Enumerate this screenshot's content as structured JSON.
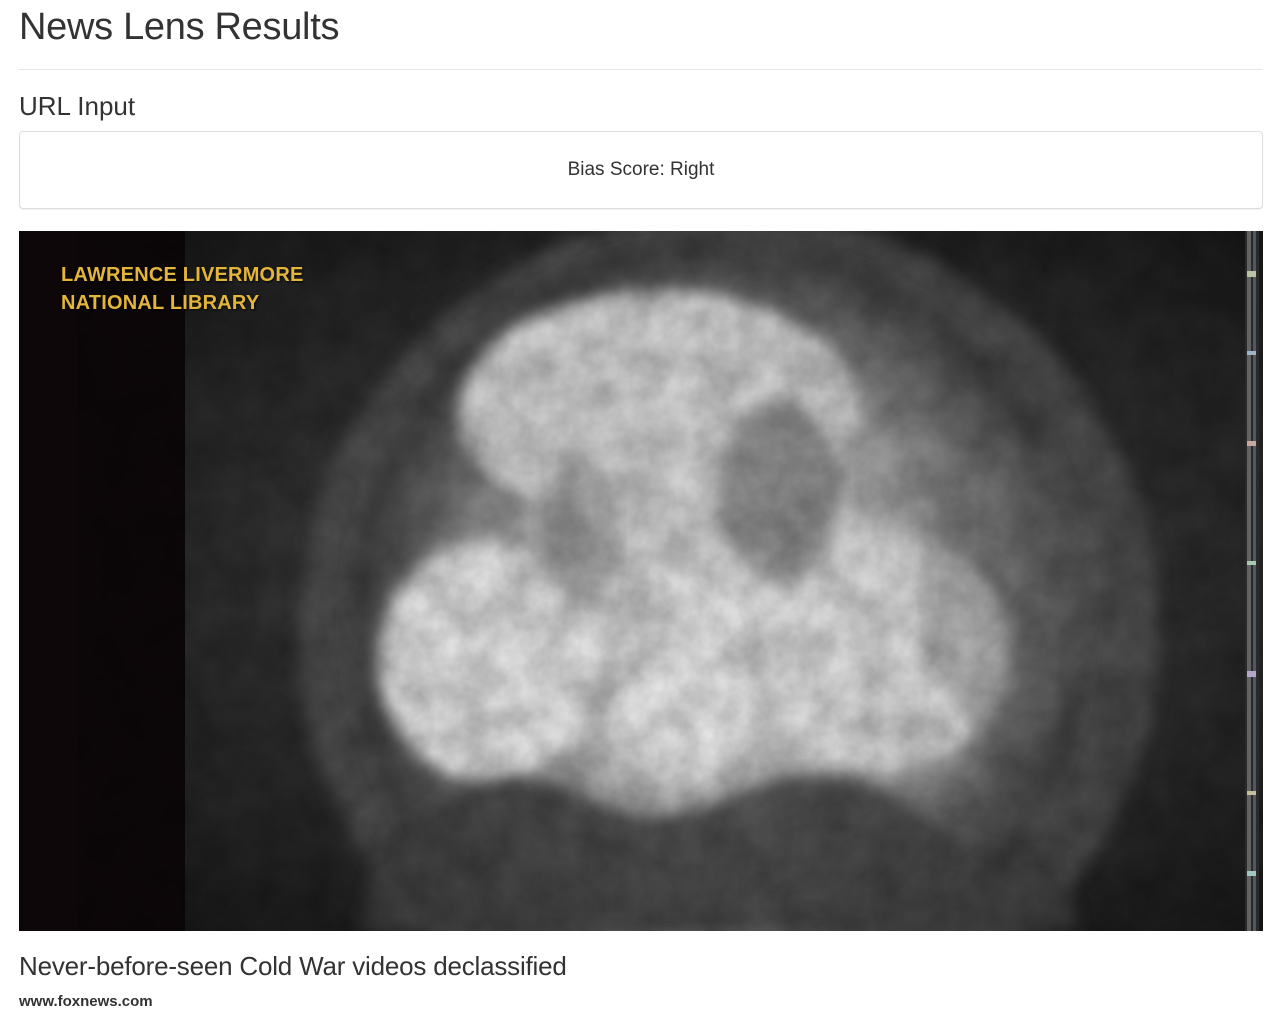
{
  "header": {
    "title": "News Lens Results"
  },
  "url_input": {
    "heading": "URL Input",
    "bias_label": "Bias Score: Right"
  },
  "article": {
    "image": {
      "watermark_line1": "LAWRENCE LIVERMORE",
      "watermark_line2": "NATIONAL LIBRARY",
      "watermark_color": "#e3b53a"
    },
    "title": "Never-before-seen Cold War videos declassified",
    "source": "www.foxnews.com"
  }
}
